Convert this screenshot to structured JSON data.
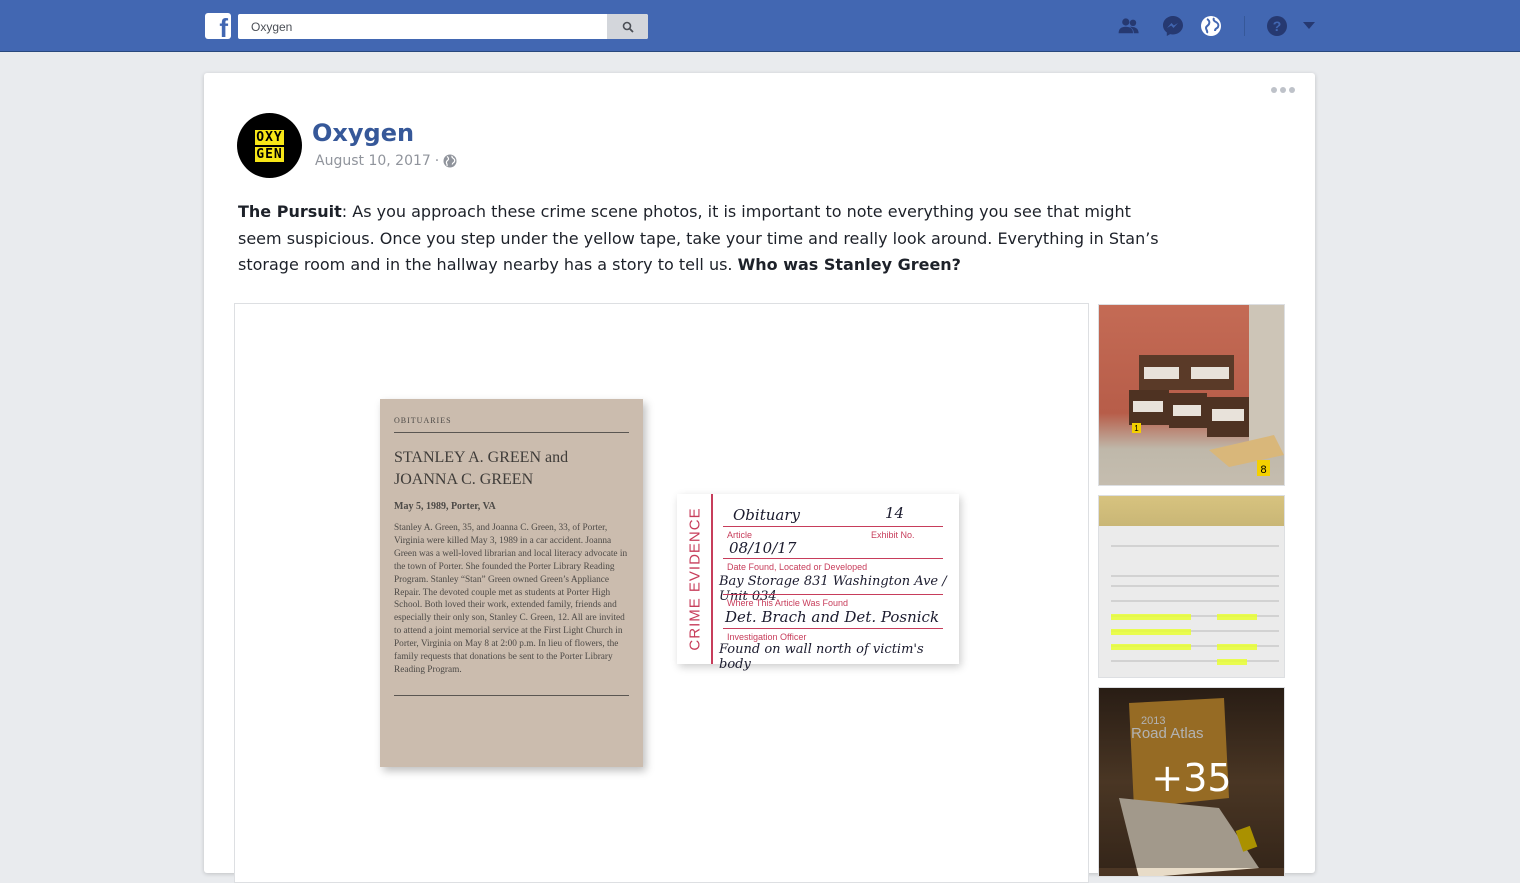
{
  "topbar": {
    "logo": "f",
    "search_value": "Oxygen",
    "icons": [
      "friends-icon",
      "messenger-icon",
      "globe-icon",
      "help-icon",
      "caret-down-icon"
    ]
  },
  "post": {
    "page_name": "Oxygen",
    "avatar_text": [
      "OXY",
      "GEN"
    ],
    "date": "August 10, 2017",
    "separator": "·",
    "text_lead": "The Pursuit",
    "text_colon": ":",
    "text_body": " As you approach these crime scene photos, it is important to note everything you see that might seem suspicious. Once you step under the yellow tape, take your time and really look around. Everything in Stan’s storage room and in the hallway nearby has a story to tell us. ",
    "text_question": "Who was Stanley Green?",
    "more_photos": "+35"
  },
  "photo": {
    "newspaper": {
      "section": "OBITUARIES",
      "headline_1": "STANLEY A. GREEN and",
      "headline_2": "JOANNA C. GREEN",
      "dateline": "May 5, 1989, Porter, VA",
      "body": "Stanley A. Green, 35, and Joanna C. Green, 33, of Porter, Virginia were killed May 3, 1989 in a car accident. Joanna Green was a well-loved librarian and local literacy advocate in the town of Porter. She founded the Porter Library Reading Program. Stanley “Stan” Green owned Green’s Appliance Repair. The devoted couple met as students at Porter High School. Both loved their work, extended family, friends and especially their only son, Stanley C. Green, 12. All are invited to attend a joint memorial service at the First Light Church in Porter, Virginia on May 8 at 2:00 p.m. In lieu of flowers, the family requests that donations be sent to the Porter Library Reading Program."
    },
    "evidence_tag": {
      "side": "CRIME EVIDENCE",
      "article_value": "Obituary",
      "exhibit_value": "14",
      "article_label": "Article",
      "exhibit_label": "Exhibit No.",
      "date_value": "08/10/17",
      "date_label": "Date Found, Located or Developed",
      "where_value": "Bay Storage 831 Washington Ave / Unit 034",
      "where_label": "Where This Article Was Found",
      "officer_value": "Det. Brach and Det. Posnick",
      "officer_label": "Investigation Officer",
      "note_value": "Found on wall north of victim's body"
    }
  },
  "thumbs": {
    "t1_marker_a": "1",
    "t1_marker_b": "8",
    "t3_atlas_title": "Road Atlas",
    "t3_atlas_year": "2013"
  }
}
